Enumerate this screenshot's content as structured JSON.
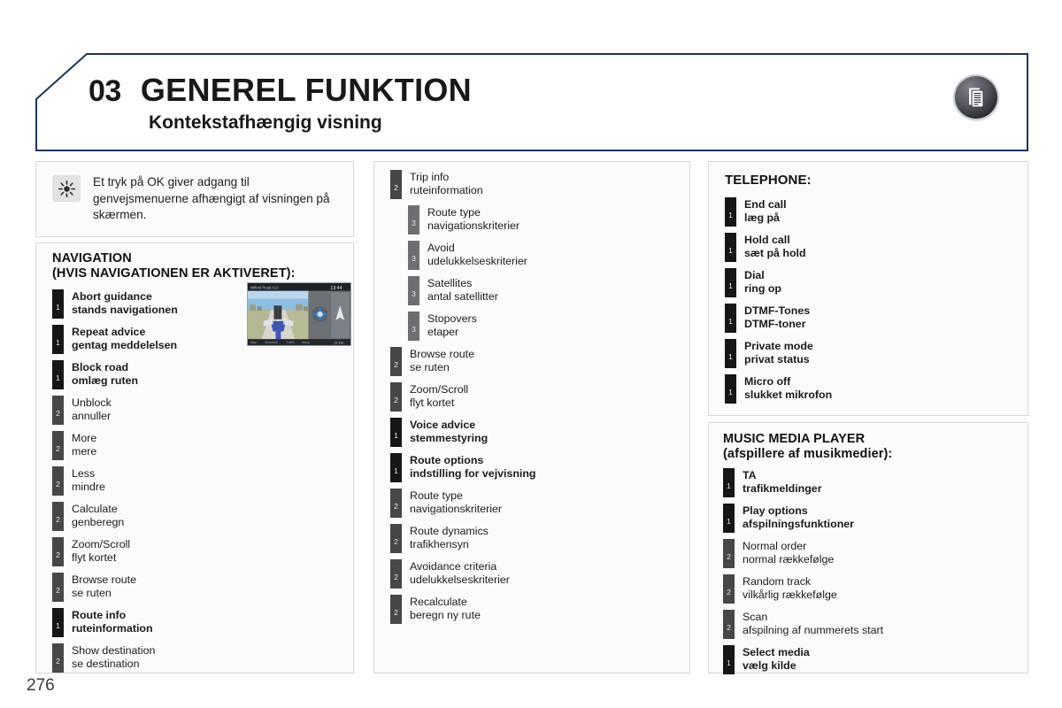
{
  "header": {
    "chapter_number": "03",
    "title": "GENEREL FUNKTION",
    "subtitle": "Kontekstafhængig visning",
    "badge_icon": "document-list-icon",
    "border_color": "#1b3558"
  },
  "info_note": {
    "icon": "sun-icon",
    "text": "Et tryk på OK giver adgang til genvejsmenuerne afhængigt af visningen på skærmen."
  },
  "navigation": {
    "heading_line1": "NAVIGATION",
    "heading_line2": "(HVIS NAVIGATIONEN ER AKTIVERET):",
    "thumbnail_alt": "navigation-map-screenshot",
    "items": [
      {
        "level": "1",
        "en": "Abort guidance",
        "da": "stands navigationen"
      },
      {
        "level": "1",
        "en": "Repeat advice",
        "da": "gentag meddelelsen"
      },
      {
        "level": "1",
        "en": "Block road",
        "da": "omlæg ruten"
      },
      {
        "level": "2",
        "en": "Unblock",
        "da": "annuller"
      },
      {
        "level": "2",
        "en": "More",
        "da": "mere"
      },
      {
        "level": "2",
        "en": "Less",
        "da": "mindre"
      },
      {
        "level": "2",
        "en": "Calculate",
        "da": "genberegn"
      },
      {
        "level": "2",
        "en": "Zoom/Scroll",
        "da": "flyt kortet"
      },
      {
        "level": "2",
        "en": "Browse route",
        "da": "se ruten"
      },
      {
        "level": "1",
        "en": "Route info",
        "da": "ruteinformation"
      },
      {
        "level": "2",
        "en": "Show destination",
        "da": "se destination"
      }
    ]
  },
  "middle_column": {
    "items": [
      {
        "level": "2",
        "en": "Trip info",
        "da": "ruteinformation"
      },
      {
        "level": "3",
        "en": "Route type",
        "da": "navigationskriterier"
      },
      {
        "level": "3",
        "en": "Avoid",
        "da": "udelukkelseskriterier"
      },
      {
        "level": "3",
        "en": "Satellites",
        "da": "antal satellitter"
      },
      {
        "level": "3",
        "en": "Stopovers",
        "da": "etaper"
      },
      {
        "level": "2",
        "en": "Browse route",
        "da": "se ruten"
      },
      {
        "level": "2",
        "en": "Zoom/Scroll",
        "da": "flyt kortet"
      },
      {
        "level": "1",
        "en": "Voice advice",
        "da": "stemmestyring"
      },
      {
        "level": "1",
        "en": "Route options",
        "da": "indstilling for vejvisning"
      },
      {
        "level": "2",
        "en": "Route type",
        "da": "navigationskriterier"
      },
      {
        "level": "2",
        "en": "Route dynamics",
        "da": "trafikhensyn"
      },
      {
        "level": "2",
        "en": "Avoidance criteria",
        "da": "udelukkelseskriterier"
      },
      {
        "level": "2",
        "en": "Recalculate",
        "da": "beregn ny rute"
      }
    ]
  },
  "telephone": {
    "heading": "TELEPHONE:",
    "items": [
      {
        "level": "1",
        "en": "End call",
        "da": "læg på"
      },
      {
        "level": "1",
        "en": "Hold call",
        "da": "sæt på hold"
      },
      {
        "level": "1",
        "en": "Dial",
        "da": "ring op"
      },
      {
        "level": "1",
        "en": "DTMF-Tones",
        "da": "DTMF-toner"
      },
      {
        "level": "1",
        "en": "Private mode",
        "da": "privat status"
      },
      {
        "level": "1",
        "en": "Micro off",
        "da": "slukket mikrofon"
      }
    ]
  },
  "music_media_player": {
    "heading_line1": "MUSIC MEDIA PLAYER",
    "heading_line2": "(afspillere af musikmedier):",
    "items": [
      {
        "level": "1",
        "en": "TA",
        "da": "trafikmeldinger"
      },
      {
        "level": "1",
        "en": "Play options",
        "da": "afspilningsfunktioner"
      },
      {
        "level": "2",
        "en": "Normal order",
        "da": "normal rækkefølge"
      },
      {
        "level": "2",
        "en": "Random track",
        "da": "vilkårlig rækkefølge"
      },
      {
        "level": "2",
        "en": "Scan",
        "da": "afspilning af nummerets start"
      },
      {
        "level": "1",
        "en": "Select media",
        "da": "vælg kilde"
      }
    ]
  },
  "footer": {
    "page_number": "276"
  }
}
